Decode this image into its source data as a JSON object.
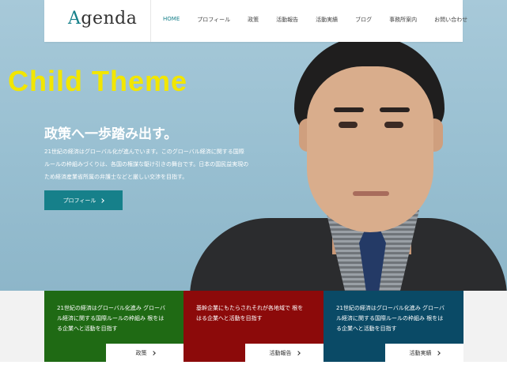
{
  "logo": {
    "first_letter": "A",
    "rest": "genda"
  },
  "nav": [
    {
      "label": "HOME",
      "active": true
    },
    {
      "label": "プロフィール",
      "active": false
    },
    {
      "label": "政策",
      "active": false
    },
    {
      "label": "活動報告",
      "active": false
    },
    {
      "label": "活動実績",
      "active": false
    },
    {
      "label": "ブログ",
      "active": false
    },
    {
      "label": "事務所案内",
      "active": false
    },
    {
      "label": "お問い合わせ",
      "active": false
    }
  ],
  "overlay_label": "Child Theme",
  "hero": {
    "title": "政策へ一歩踏み出す。",
    "body_lines": [
      "21世紀の経済はグローバル化が進んでいます。このグローバル経済に関する国際",
      "ルールの枠組みづくりは、各国の権謀な駆け引きの舞台です。日本の国民益実現の",
      "ため経済産業省所属の弁護士などと厳しい交渉を目指す。"
    ],
    "button_label": "プロフィール"
  },
  "cards": [
    {
      "lines": [
        "21世紀の経済はグローバル化進み グローバ",
        "ル経済に関する国際ルールの枠組み 根をは",
        "る企業へと活動を目指す"
      ],
      "link_label": "政策"
    },
    {
      "lines": [
        "基幹企業にもたらされそれが各地域で 根を",
        "はる企業へと活動を目指す"
      ],
      "link_label": "活動報告"
    },
    {
      "lines": [
        "21世紀の経済はグローバル化進み グローバ",
        "ル経済に関する国際ルールの枠組み 根をは",
        "る企業へと活動を目指す"
      ],
      "link_label": "活動実績"
    }
  ],
  "colors": {
    "accent": "#16808a",
    "card_green": "#1f6a14",
    "card_red": "#8c0a0a",
    "card_blue": "#0a4a66",
    "overlay_yellow": "#f2e600"
  }
}
